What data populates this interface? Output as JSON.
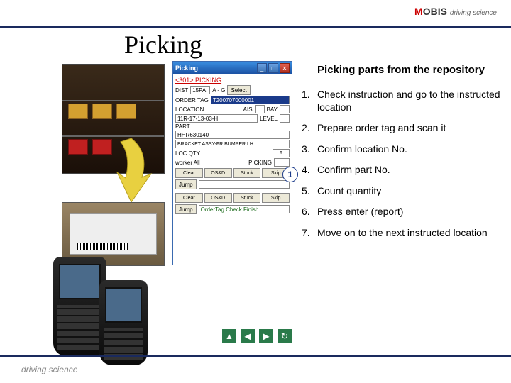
{
  "brand": {
    "name": "MOBIS",
    "tagline": "driving science"
  },
  "title": "Picking",
  "subtitle": "Picking parts from the repository",
  "steps": [
    "Check instruction and go to the instructed location",
    "Prepare order tag and scan it",
    "Confirm location No.",
    "Confirm part No.",
    "Count quantity",
    "Press enter (report)",
    "Move on to the next instructed location"
  ],
  "app": {
    "title": "Picking",
    "header": "<301> PICKING",
    "dist_label": "DIST",
    "dist_val": "15PA",
    "range": "A - G",
    "select_btn": "Select",
    "order_label": "ORDER TAG",
    "order_val": "T200707000001",
    "loc_label": "LOCATION",
    "ais_label": "AIS",
    "bay_label": "BAY",
    "loc_val": "11R-17-13-03-H",
    "level_label": "LEVEL",
    "part_label": "PART",
    "part_no": "HHR630140",
    "part_name": "BRACKET ASSY-FR BUMPER LH",
    "qty_label": "LOC QTY",
    "qty_val": "5",
    "worker_label": "worker All",
    "picking_label": "PICKING",
    "btns": {
      "clear": "Clear",
      "osd": "OS&D",
      "stuck": "Stuck",
      "skip": "Skip",
      "jump": "Jump"
    },
    "status": "OrderTag Check Finish."
  },
  "bubble": "1",
  "footer": "driving science",
  "nav_icons": [
    "up-icon",
    "left-icon",
    "right-icon",
    "reload-icon"
  ]
}
